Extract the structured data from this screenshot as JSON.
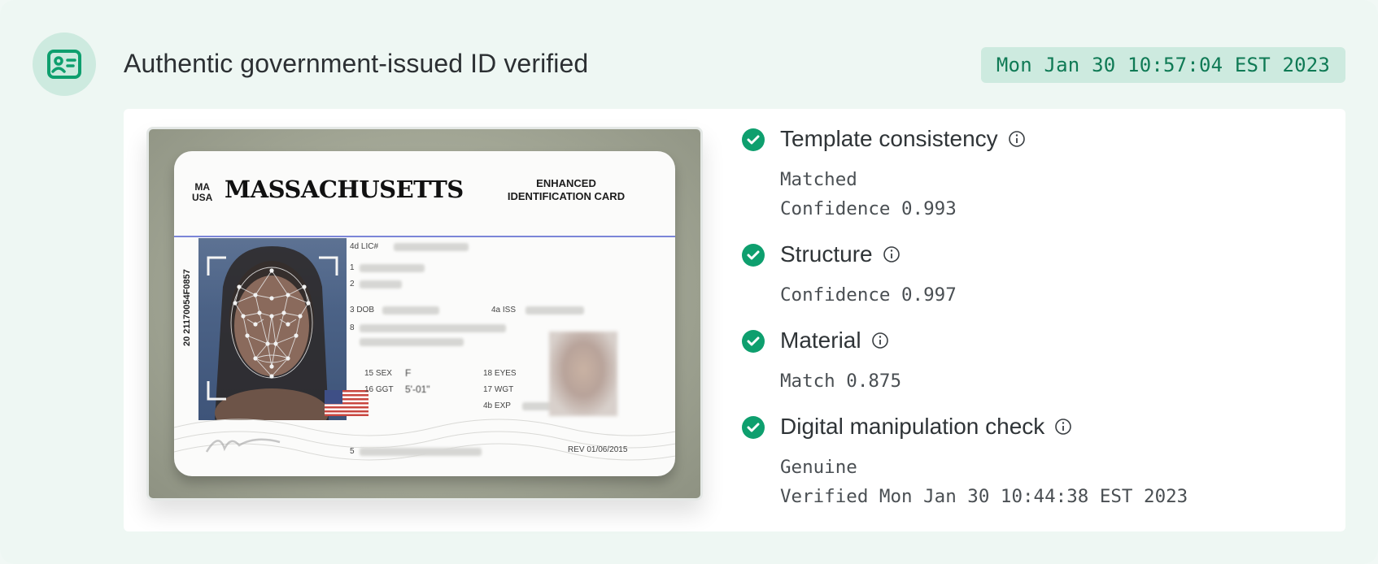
{
  "header": {
    "icon": "id-card-icon",
    "title": "Authentic government-issued ID verified",
    "timestamp": "Mon Jan 30 10:57:04 EST 2023"
  },
  "id_card": {
    "state_abbrev_line1": "MA",
    "state_abbrev_line2": "USA",
    "state": "MASSACHUSETTS",
    "type_line1": "ENHANCED",
    "type_line2": "IDENTIFICATION CARD",
    "vertical_number": "20  21170054F0857",
    "labels": {
      "lic": "4d LIC#",
      "last": "1",
      "first": "2",
      "dob": "3 DOB",
      "iss": "4a ISS",
      "addr": "8",
      "sex": "15 SEX",
      "sex_value": "F",
      "ggt": "16 GGT",
      "ggt_value": "5'-01\"",
      "eyes": "18 EYES",
      "wgt": "17 WGT",
      "exp": "4b EXP",
      "dd": "5",
      "rev": "REV 01/06/2015"
    }
  },
  "checks": [
    {
      "title": "Template consistency",
      "status": "passed",
      "lines": [
        "Matched",
        "Confidence 0.993"
      ]
    },
    {
      "title": "Structure",
      "status": "passed",
      "lines": [
        "Confidence 0.997"
      ]
    },
    {
      "title": "Material",
      "status": "passed",
      "lines": [
        "Match 0.875"
      ]
    },
    {
      "title": "Digital manipulation check",
      "status": "passed",
      "lines": [
        "Genuine",
        "Verified Mon Jan 30 10:44:38 EST 2023"
      ]
    }
  ],
  "colors": {
    "accent": "#0e9f6e",
    "accent_bg": "#cdeadf",
    "page_bg": "#eef7f3"
  }
}
